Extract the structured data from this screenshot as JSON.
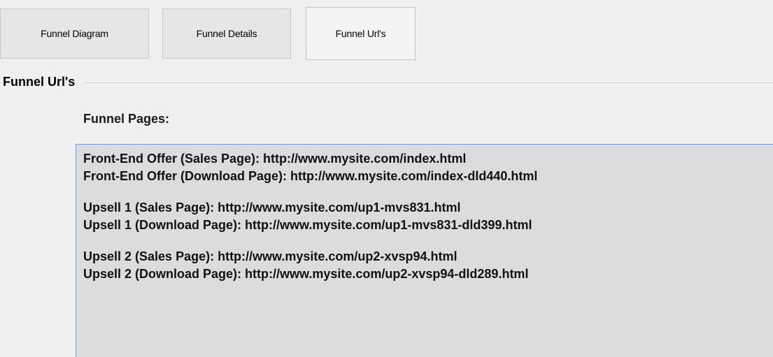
{
  "tabs": [
    {
      "label": "Funnel Diagram",
      "active": false
    },
    {
      "label": "Funnel Details",
      "active": false
    },
    {
      "label": "Funnel Url's",
      "active": true
    }
  ],
  "group": {
    "title": "Funnel Url's"
  },
  "pages_label": "Funnel Pages:",
  "pages": [
    [
      "Front-End Offer (Sales Page): http://www.mysite.com/index.html",
      "Front-End Offer (Download Page): http://www.mysite.com/index-dld440.html"
    ],
    [
      "Upsell 1 (Sales Page): http://www.mysite.com/up1-mvs831.html",
      "Upsell 1 (Download Page): http://www.mysite.com/up1-mvs831-dld399.html"
    ],
    [
      "Upsell 2 (Sales Page): http://www.mysite.com/up2-xvsp94.html",
      "Upsell 2 (Download Page): http://www.mysite.com/up2-xvsp94-dld289.html"
    ]
  ]
}
